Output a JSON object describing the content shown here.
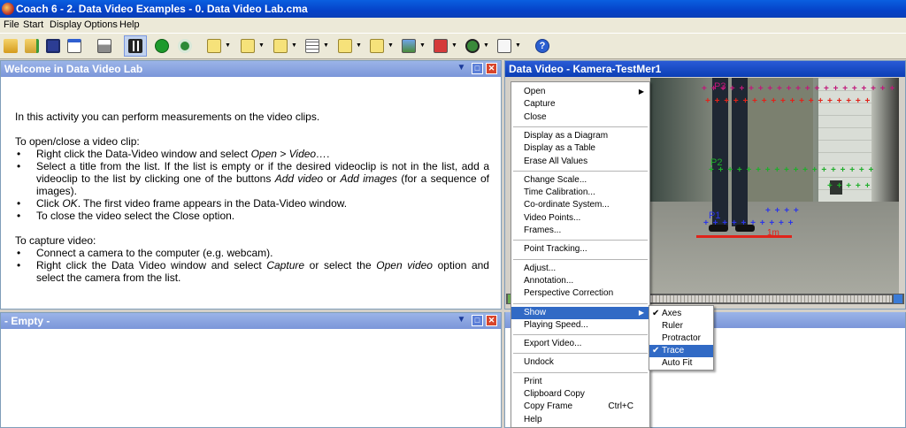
{
  "window": {
    "title": "Coach 6 - 2. Data Video Examples - 0. Data Video Lab.cma"
  },
  "menubar": [
    "File",
    "Start",
    "Display",
    "Options",
    "Help"
  ],
  "toolbar": {
    "icons": [
      "open-folder-icon",
      "open-icon",
      "save-icon",
      "new-window-icon",
      "print-icon",
      "video-icon",
      "play-icon",
      "refresh-icon",
      "diagram-icon",
      "meter-icon",
      "graph-icon",
      "table-icon",
      "chart-icon",
      "histogram-icon",
      "image-icon",
      "video-clip-icon",
      "globe-icon",
      "text-icon",
      "help-icon"
    ]
  },
  "welcome_panel": {
    "title": "Welcome in Data Video Lab",
    "intro": "In this activity you can perform measurements on the video clips.",
    "open_heading": "To open/close a video clip:",
    "open_steps": [
      "Right click the Data-Video window and select Open > Video….",
      "Select a title from the list. If the list is empty or if the desired videoclip is not in the list, add a videoclip to the list by clicking one of the buttons Add video or Add images (for a sequence of images).",
      "Click OK. The first video frame appears in the Data-Video window.",
      "To close the video select the Close option."
    ],
    "capture_heading": "To capture video:",
    "capture_steps": [
      "Connect a camera to the computer (e.g. webcam).",
      "Right click the Data Video window and select Capture or select the Open video option and select the camera from the list."
    ]
  },
  "empty_panel": {
    "title": "- Empty -"
  },
  "video_panel": {
    "title": "Data Video - Kamera-TestMer1",
    "point_labels": [
      "P3",
      "P2",
      "P1"
    ],
    "ruler_label": "1m"
  },
  "context_menu": {
    "items": [
      {
        "label": "Open",
        "submenu": true
      },
      {
        "label": "Capture"
      },
      {
        "label": "Close"
      },
      {
        "sep": true
      },
      {
        "label": "Display as a Diagram"
      },
      {
        "label": "Display as a Table"
      },
      {
        "label": "Erase All Values"
      },
      {
        "sep": true
      },
      {
        "label": "Change Scale..."
      },
      {
        "label": "Time Calibration..."
      },
      {
        "label": "Co-ordinate System..."
      },
      {
        "label": "Video Points..."
      },
      {
        "label": "Frames..."
      },
      {
        "sep": true
      },
      {
        "label": "Point Tracking..."
      },
      {
        "sep": true
      },
      {
        "label": "Adjust..."
      },
      {
        "label": "Annotation..."
      },
      {
        "label": "Perspective Correction"
      },
      {
        "sep": true
      },
      {
        "label": "Show",
        "submenu": true,
        "highlighted": true
      },
      {
        "label": "Playing Speed..."
      },
      {
        "sep": true
      },
      {
        "label": "Export Video..."
      },
      {
        "sep": true
      },
      {
        "label": "Undock"
      },
      {
        "sep": true
      },
      {
        "label": "Print"
      },
      {
        "label": "Clipboard Copy"
      },
      {
        "label": "Copy Frame",
        "shortcut": "Ctrl+C"
      },
      {
        "label": "Help"
      }
    ]
  },
  "show_submenu": {
    "items": [
      {
        "label": "Axes",
        "checked": true
      },
      {
        "label": "Ruler",
        "checked": false
      },
      {
        "label": "Protractor",
        "checked": false
      },
      {
        "label": "Trace",
        "checked": true,
        "highlighted": true
      },
      {
        "label": "Auto Fit",
        "checked": false
      }
    ]
  },
  "colors": {
    "titlebar": "#0542c8",
    "panel_header": "#7b96d9",
    "active_header": "#0b3eb5",
    "menu_highlight": "#316ac5",
    "trace_p3": "#c0187a",
    "trace_p2": "#1fae2a",
    "trace_p1": "#2b35e8"
  }
}
